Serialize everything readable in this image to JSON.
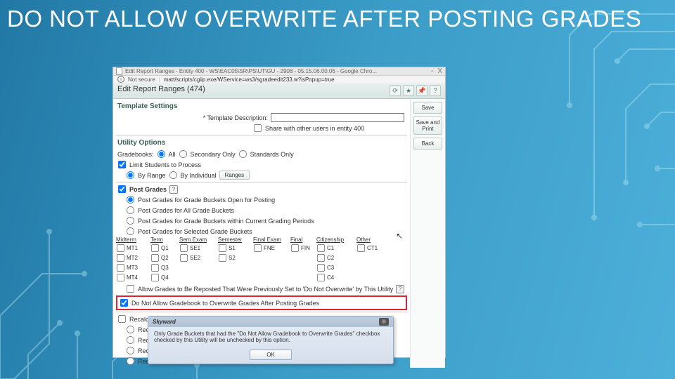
{
  "slide_title": "DO NOT ALLOW OVERWRITE AFTER POSTING GRADES",
  "chrome": {
    "tab": "Edit Report Ranges - Entity 400 - WS\\EAC05\\SR\\PS\\UT\\GU - 2908 - 05.15.06.00.06 - Google Chro...",
    "min": "-",
    "close": "X"
  },
  "url": {
    "not_secure": "Not secure",
    "text": "matt/scripts/cgiip.exe/WService=ws3/sgradeedit233.w?isPopup=true"
  },
  "dialog": {
    "title": "Edit Report Ranges (474)"
  },
  "tools": {
    "refresh": "⟳",
    "star": "★",
    "pin": "📌",
    "help": "?"
  },
  "side": {
    "save": "Save",
    "save_print": "Save and Print",
    "back": "Back"
  },
  "template": {
    "section": "Template Settings",
    "desc_label": "* Template Description:",
    "share": "Share with other users in entity 400"
  },
  "utility": {
    "section": "Utility Options",
    "gradebooks": "Gradebooks:",
    "all": "All",
    "secondary": "Secondary Only",
    "standards": "Standards Only",
    "limit": "Limit Students to Process",
    "by_range": "By Range",
    "by_individual": "By Individual",
    "ranges_btn": "Ranges"
  },
  "post": {
    "section": "Post Grades",
    "r1": "Post Grades for Grade Buckets Open for Posting",
    "r2": "Post Grades for All Grade Buckets",
    "r3": "Post Grades for Grade Buckets within Current Grading Periods",
    "r4": "Post Grades for Selected Grade Buckets"
  },
  "cols": {
    "midterm": "Midterm",
    "term": "Term",
    "semexam": "Sem Exam",
    "semester": "Semester",
    "finalexam": "Final Exam",
    "final": "Final",
    "citizenship": "Citizenship",
    "other": "Other"
  },
  "cells": {
    "mt1": "MT1",
    "mt2": "MT2",
    "mt3": "MT3",
    "mt4": "MT4",
    "q1": "Q1",
    "q2": "Q2",
    "q3": "Q3",
    "q4": "Q4",
    "se1": "SE1",
    "se2": "SE2",
    "s1": "S1",
    "s2": "S2",
    "fne": "FNE",
    "fin": "FIN",
    "c1": "C1",
    "c2": "C2",
    "c3": "C3",
    "c4": "C4",
    "ct1": "CT1"
  },
  "allow_reposted": "Allow Grades to Be Reposted That Were Previously Set to 'Do Not Overwrite' by This Utility",
  "red_label": "Do Not Allow Gradebook to Overwrite Grades After Posting Grades",
  "recalc": {
    "r0": "Recalculate",
    "r1": "Recalculate",
    "r2": "Recalculate",
    "r3": "Recalculate",
    "r4": "Recalculate"
  },
  "tip": {
    "title": "Skyward",
    "body": "Only Grade Buckets that had the \"Do Not Allow Gradebook to Overwrite Grades\" checkbox checked by this Utility will be unchecked by this option.",
    "ok": "OK"
  }
}
